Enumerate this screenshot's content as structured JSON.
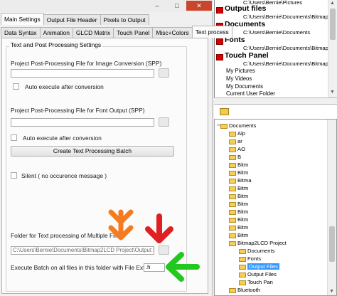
{
  "window": {
    "buttons": {
      "minimize": "–",
      "maximize": "□",
      "close": "✕"
    }
  },
  "tabs_row1": [
    "Main Settings",
    "Output File Header",
    "Pixels to Output"
  ],
  "tabs_row2": [
    "Data Syntax",
    "Animation",
    "GLCD Matrix",
    "Touch Panel",
    "Misc+Colors",
    "Text process"
  ],
  "group": {
    "title": "Text and Post Processing Settings",
    "spp_image_label": "Project Post-Processing File for Image Conversion (SPP)",
    "auto_exec_1": "Auto execute after conversion",
    "spp_font_label": "Project Post-Processing File for Font Output (SPP)",
    "auto_exec_2": "Auto execute after conversion",
    "create_batch_button": "Create Text Processing Batch",
    "silent_label": "Silent ( no occurence message )",
    "folder_label": "Folder for Text processing of Multiple Files",
    "folder_value": "C:\\Users\\Bernie\\Documents\\Bitmap2LCD Project\\Output Files",
    "execute_label": "Execute Batch on all files in this folder with File Extension",
    "extension_value": ".h"
  },
  "favorites": [
    {
      "name": "Output files",
      "path": "C:\\Users\\Bernie\\Documents\\Bitmap2LCD Proje"
    },
    {
      "name": "Documents",
      "path": "C:\\Users\\Bernie\\Documents"
    },
    {
      "name": "Fonts",
      "path": "C:\\Users\\Bernie\\Documents\\Bitmap2LCD Proje"
    },
    {
      "name": "Touch Panel",
      "path": "C:\\Users\\Bernie\\Documents\\Bitmap2LCD Proje"
    }
  ],
  "favorites_partial_path": "C:\\Users\\Bernie\\Pictures",
  "special_folders": [
    "My Pictures",
    "My Videos",
    "My Documents",
    "Current User Folder"
  ],
  "tree": {
    "root": "Documents",
    "items": [
      "Alp",
      "ar",
      "AO",
      "B",
      "Bitm",
      "Bitm",
      "Bitma",
      "Bitm",
      "Bitm",
      "Bitm",
      "Bitm",
      "Bitm",
      "Bitm",
      "Bitm",
      "Bitmap2LCD Project"
    ],
    "children": [
      "Documents",
      "Fonts",
      "Output Files",
      "Output Files",
      "Touch Pan"
    ],
    "tail": [
      "Bluetooth",
      "Bluetooth"
    ]
  },
  "colors": {
    "orange_arrow": "#f47b20",
    "red_arrow": "#e02020",
    "green_arrow": "#22c81e",
    "blue_arrow": "#1f56c8",
    "selection": "#3399ff",
    "favorite_red": "#d90000"
  }
}
